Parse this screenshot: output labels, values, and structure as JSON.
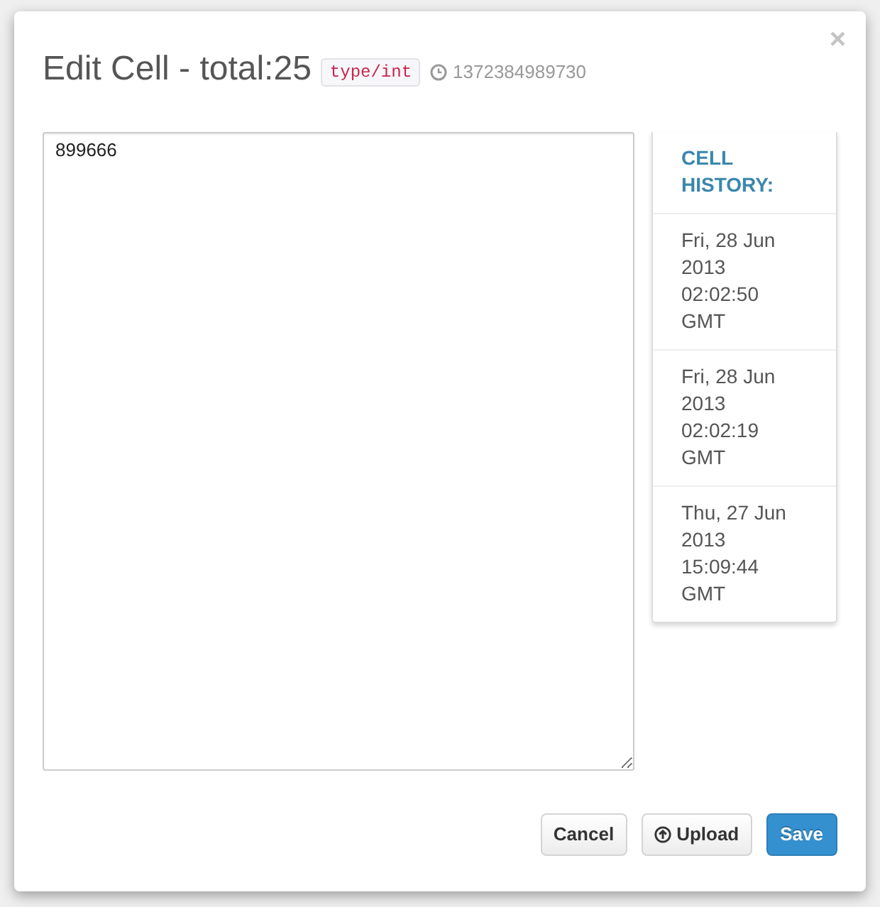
{
  "dialog": {
    "title": "Edit Cell - total:25",
    "type_badge": "type/int",
    "timestamp": "1372384989730",
    "close_label": "×"
  },
  "editor": {
    "value": "899666"
  },
  "history": {
    "heading": "CELL HISTORY:",
    "entries": [
      "Fri, 28 Jun 2013 02:02:50 GMT",
      "Fri, 28 Jun 2013 02:02:19 GMT",
      "Thu, 27 Jun 2013 15:09:44 GMT"
    ]
  },
  "buttons": [
    {
      "label": "Cancel",
      "kind": "default"
    },
    {
      "label": "Upload",
      "kind": "upload"
    },
    {
      "label": "Save",
      "kind": "primary"
    }
  ]
}
